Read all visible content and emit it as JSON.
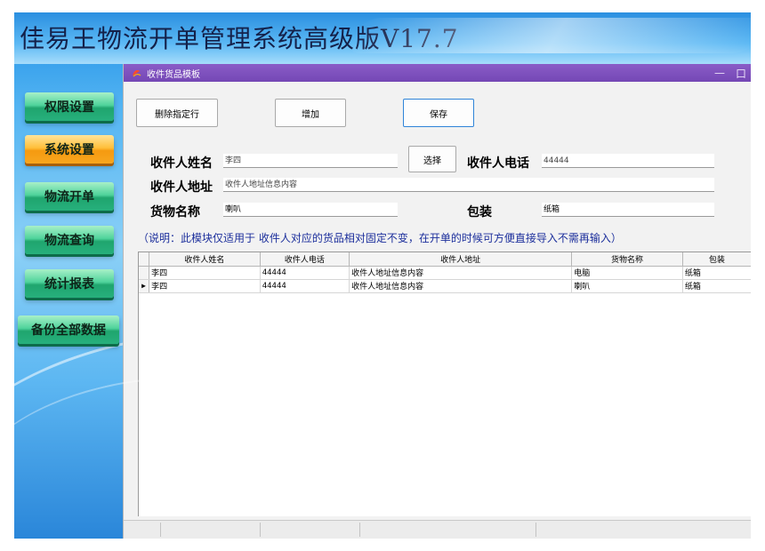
{
  "app": {
    "title": "佳易王物流开单管理系统高级版V17.7"
  },
  "sidebar": {
    "items": [
      {
        "label": "权限设置",
        "active": false
      },
      {
        "label": "系统设置",
        "active": true
      },
      {
        "label": "物流开单",
        "active": false
      },
      {
        "label": "物流查询",
        "active": false
      },
      {
        "label": "统计报表",
        "active": false
      },
      {
        "label": "备份全部数据",
        "active": false
      }
    ]
  },
  "window": {
    "title": "收件货品模板",
    "minimize": "—",
    "maximize": "口"
  },
  "toolbar": {
    "delete_label": "删除指定行",
    "add_label": "增加",
    "save_label": "保存"
  },
  "form": {
    "name_label": "收件人姓名",
    "name_value": "李四",
    "select_label": "选择",
    "phone_label": "收件人电话",
    "phone_value": "44444",
    "address_label": "收件人地址",
    "address_value": "收件人地址信息内容",
    "goods_label": "货物名称",
    "goods_value": "喇叭",
    "package_label": "包装",
    "package_value": "纸箱"
  },
  "hint": "（说明：此模块仅适用于 收件人对应的货品相对固定不变，在开单的时候可方便直接导入不需再输入）",
  "table": {
    "columns": [
      "收件人姓名",
      "收件人电话",
      "收件人地址",
      "货物名称",
      "包装"
    ],
    "rows": [
      {
        "pointer": "",
        "cells": [
          "李四",
          "44444",
          "收件人地址信息内容",
          "电脑",
          "纸箱"
        ]
      },
      {
        "pointer": "▶",
        "cells": [
          "李四",
          "44444",
          "收件人地址信息内容",
          "喇叭",
          "纸箱"
        ]
      }
    ]
  },
  "colors": {
    "window_title_bg": "#7a4fba",
    "hint_text": "#1c2f9c",
    "sidebar_button": "#27b07c",
    "sidebar_button_active": "#f59a10"
  }
}
